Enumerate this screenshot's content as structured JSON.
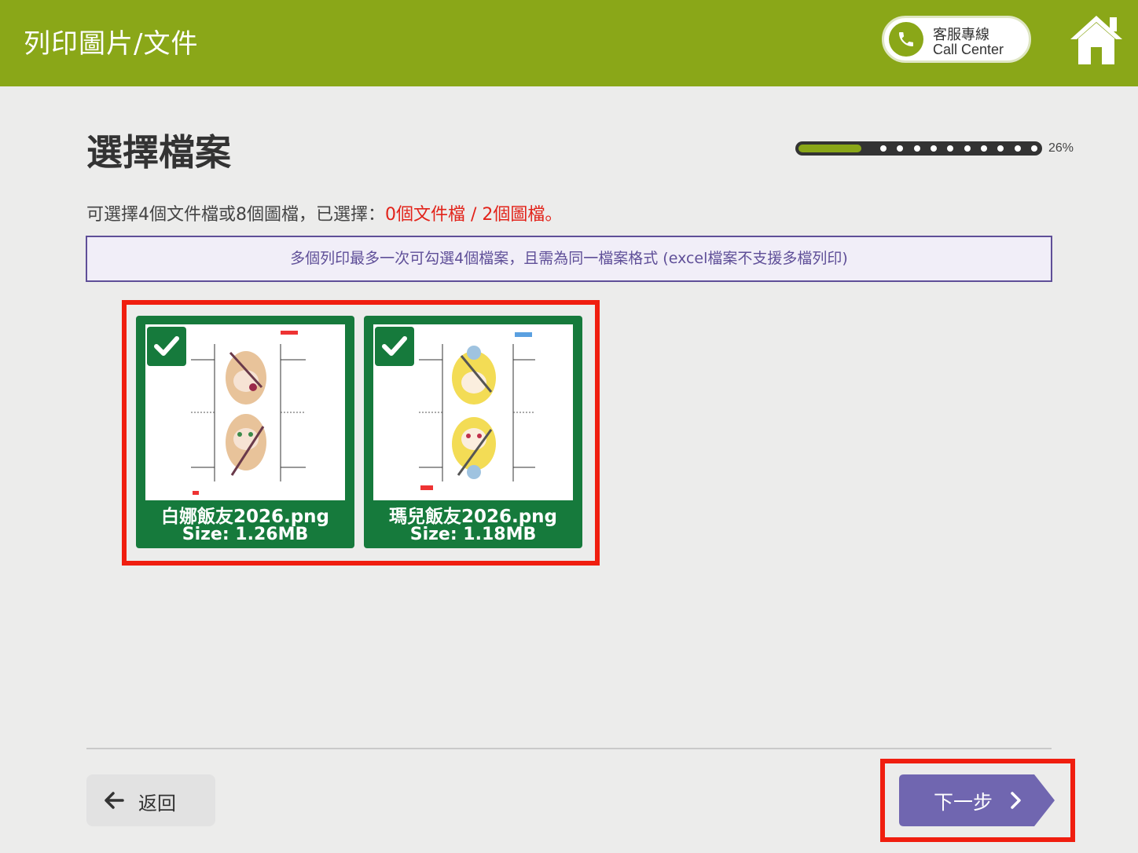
{
  "header": {
    "title": "列印圖片/文件",
    "call_center": {
      "label_zh": "客服專線",
      "label_en": "Call Center",
      "icon": "phone-icon"
    },
    "home_icon": "home-icon",
    "color": "#8aa718"
  },
  "page": {
    "title": "選擇檔案",
    "progress": {
      "percent": 26,
      "label": "26%"
    }
  },
  "info": {
    "prefix": "可選擇4個文件檔或8個圖檔，已選擇：",
    "selected": "0個文件檔 / 2個圖檔",
    "suffix": "。",
    "highlight_color": "#e2231a"
  },
  "notice": {
    "text": "多個列印最多一次可勾選4個檔案，且需為同一檔案格式 (excel檔案不支援多檔列印)"
  },
  "files": [
    {
      "name": "白娜飯友2026.png",
      "size": "Size: 1.26MB",
      "checked": true
    },
    {
      "name": "瑪兒飯友2026.png",
      "size": "Size: 1.18MB",
      "checked": true
    }
  ],
  "footer": {
    "back_label": "返回",
    "next_label": "下一步",
    "next_color": "#7066b0"
  }
}
